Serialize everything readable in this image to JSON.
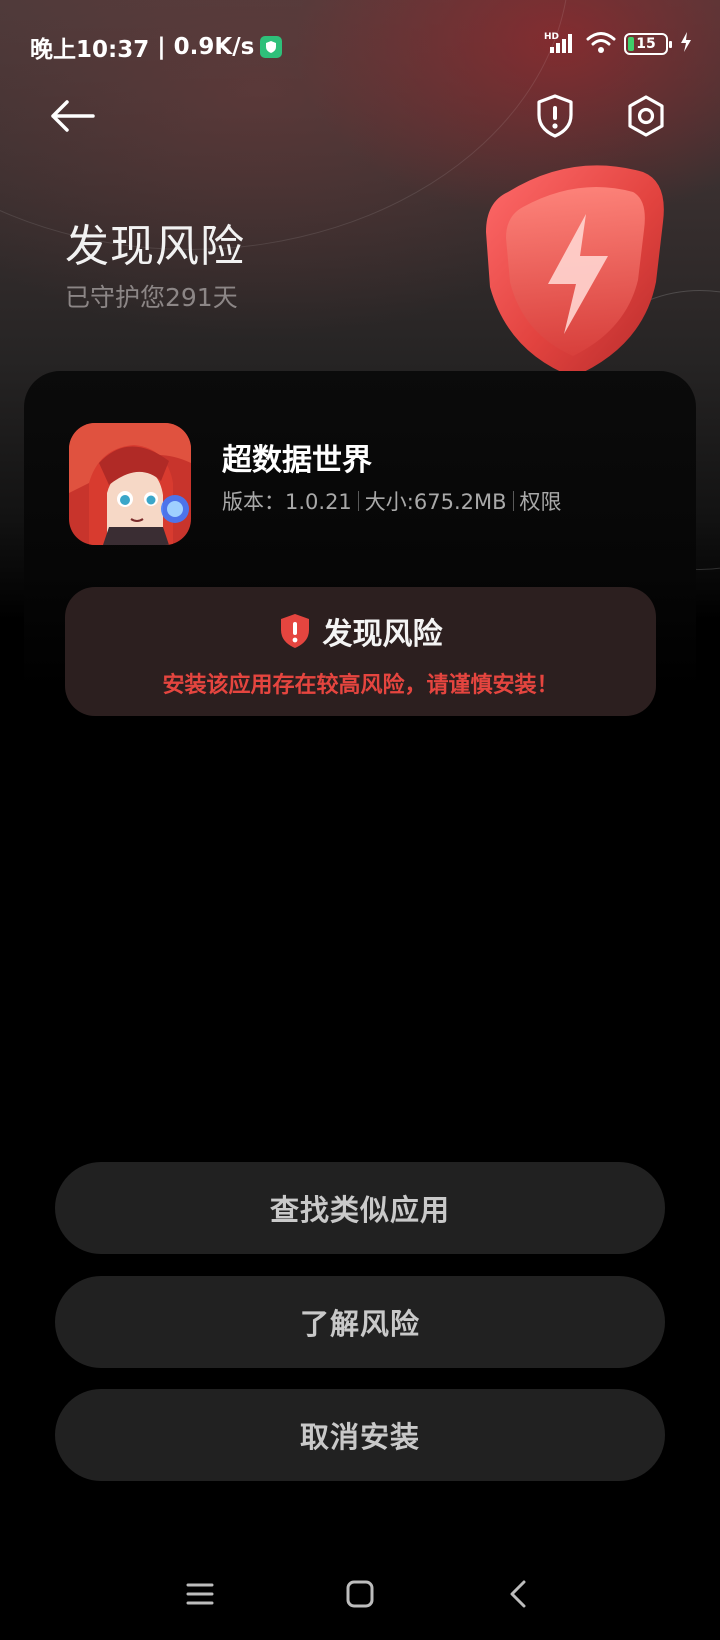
{
  "status_bar": {
    "time": "晚上10:37",
    "net_speed": "0.9K/s",
    "battery": "15"
  },
  "header": {
    "title": "发现风险",
    "subtitle": "已守护您291天"
  },
  "app": {
    "name": "超数据世界",
    "version": "版本：1.0.21",
    "size": "大小:675.2MB",
    "permissions": "权限"
  },
  "risk": {
    "title": "发现风险",
    "message": "安装该应用存在较高风险，请谨慎安装！"
  },
  "buttons": {
    "find_similar": "查找类似应用",
    "learn_risk": "了解风险",
    "cancel_install": "取消安装"
  },
  "colors": {
    "risk_red": "#e5453f",
    "shield_red": "#e84a4a",
    "button_bg": "#212121",
    "risk_box_bg": "#2c1f1f"
  },
  "icons": {
    "back": "arrow-left-icon",
    "report": "shield-alert-icon",
    "settings": "gear-icon",
    "risk": "shield-exclamation-icon",
    "nav_menu": "menu-icon",
    "nav_home": "square-icon",
    "nav_back": "chevron-left-icon"
  }
}
